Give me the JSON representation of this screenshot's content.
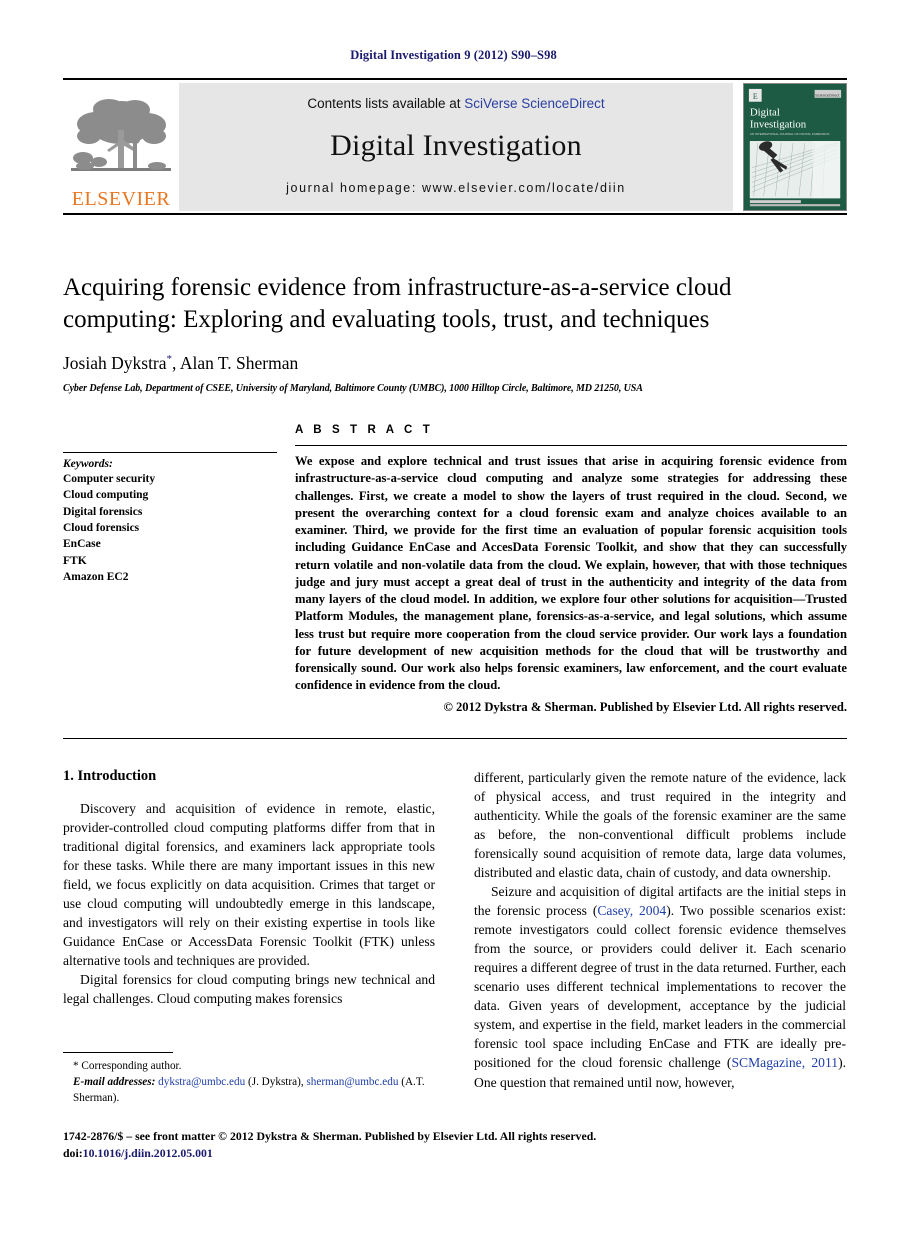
{
  "running_head": "Digital Investigation 9 (2012) S90–S98",
  "banner": {
    "publisher_name": "ELSEVIER",
    "contents_prefix": "Contents lists available at ",
    "sciencedirect_link": "SciVerse ScienceDirect",
    "journal_title": "Digital Investigation",
    "homepage": "journal homepage: www.elsevier.com/locate/diin",
    "cover": {
      "title_line1": "Digital",
      "title_line2": "Investigation",
      "subtitle": "AN INTERNATIONAL JOURNAL OF DIGITAL FORENSICS & INCIDENT RESPONSE",
      "corner_label": "ScienceDirect",
      "bg_color": "#1d5b44"
    }
  },
  "article": {
    "title": "Acquiring forensic evidence from infrastructure-as-a-service cloud computing: Exploring and evaluating tools, trust, and techniques",
    "authors": "Josiah Dykstra",
    "author_marker": "*",
    "authors_rest": ", Alan T. Sherman",
    "affiliation": "Cyber Defense Lab, Department of CSEE, University of Maryland, Baltimore County (UMBC), 1000 Hilltop Circle, Baltimore, MD 21250, USA"
  },
  "keywords": {
    "label": "Keywords:",
    "items": [
      "Computer security",
      "Cloud computing",
      "Digital forensics",
      "Cloud forensics",
      "EnCase",
      "FTK",
      "Amazon EC2"
    ]
  },
  "abstract": {
    "heading": "A B S T R A C T",
    "text": "We expose and explore technical and trust issues that arise in acquiring forensic evidence from infrastructure-as-a-service cloud computing and analyze some strategies for addressing these challenges. First, we create a model to show the layers of trust required in the cloud. Second, we present the overarching context for a cloud forensic exam and analyze choices available to an examiner. Third, we provide for the first time an evaluation of popular forensic acquisition tools including Guidance EnCase and AccesData Forensic Toolkit, and show that they can successfully return volatile and non-volatile data from the cloud. We explain, however, that with those techniques judge and jury must accept a great deal of trust in the authenticity and integrity of the data from many layers of the cloud model. In addition, we explore four other solutions for acquisition—Trusted Platform Modules, the management plane, forensics-as-a-service, and legal solutions, which assume less trust but require more cooperation from the cloud service provider. Our work lays a foundation for future development of new acquisition methods for the cloud that will be trustworthy and forensically sound. Our work also helps forensic examiners, law enforcement, and the court evaluate confidence in evidence from the cloud.",
    "copyright": "© 2012 Dykstra & Sherman. Published by Elsevier Ltd. All rights reserved."
  },
  "body": {
    "section_number_title": "1.  Introduction",
    "left_paragraphs": [
      "Discovery and acquisition of evidence in remote, elastic, provider-controlled cloud computing platforms differ from that in traditional digital forensics, and examiners lack appropriate tools for these tasks. While there are many important issues in this new field, we focus explicitly on data acquisition. Crimes that target or use cloud computing will undoubtedly emerge in this landscape, and investigators will rely on their existing expertise in tools like Guidance EnCase or AccessData Forensic Toolkit (FTK) unless alternative tools and techniques are provided.",
      "Digital forensics for cloud computing brings new technical and legal challenges. Cloud computing makes forensics"
    ],
    "right_paragraph_1": "different, particularly given the remote nature of the evidence, lack of physical access, and trust required in the integrity and authenticity. While the goals of the forensic examiner are the same as before, the non-conventional difficult problems include forensically sound acquisition of remote data, large data volumes, distributed and elastic data, chain of custody, and data ownership.",
    "right_paragraph_2_part1": "Seizure and acquisition of digital artifacts are the initial steps in the forensic process (",
    "right_citation_1": "Casey, 2004",
    "right_paragraph_2_part2": "). Two possible scenarios exist: remote investigators could collect forensic evidence themselves from the source, or providers could deliver it. Each scenario requires a different degree of trust in the data returned. Further, each scenario uses different technical implementations to recover the data. Given years of development, acceptance by the judicial system, and expertise in the field, market leaders in the commercial forensic tool space including EnCase and FTK are ideally pre-positioned for the cloud forensic challenge (",
    "right_citation_2": "SCMagazine, 2011",
    "right_paragraph_2_part3": "). One question that remained until now, however,"
  },
  "footnote": {
    "corresponding": "* Corresponding author.",
    "email_label": "E-mail addresses:",
    "email_1": "dykstra@umbc.edu",
    "email_1_owner": "(J. Dykstra),",
    "email_2": "sherman@umbc.edu",
    "email_2_owner": "(A.T. Sherman)."
  },
  "page_footer": {
    "issn_line": "1742-2876/$ – see front matter © 2012 Dykstra & Sherman. Published by Elsevier Ltd. All rights reserved.",
    "doi_label": "doi:",
    "doi_value": "10.1016/j.diin.2012.05.001"
  }
}
